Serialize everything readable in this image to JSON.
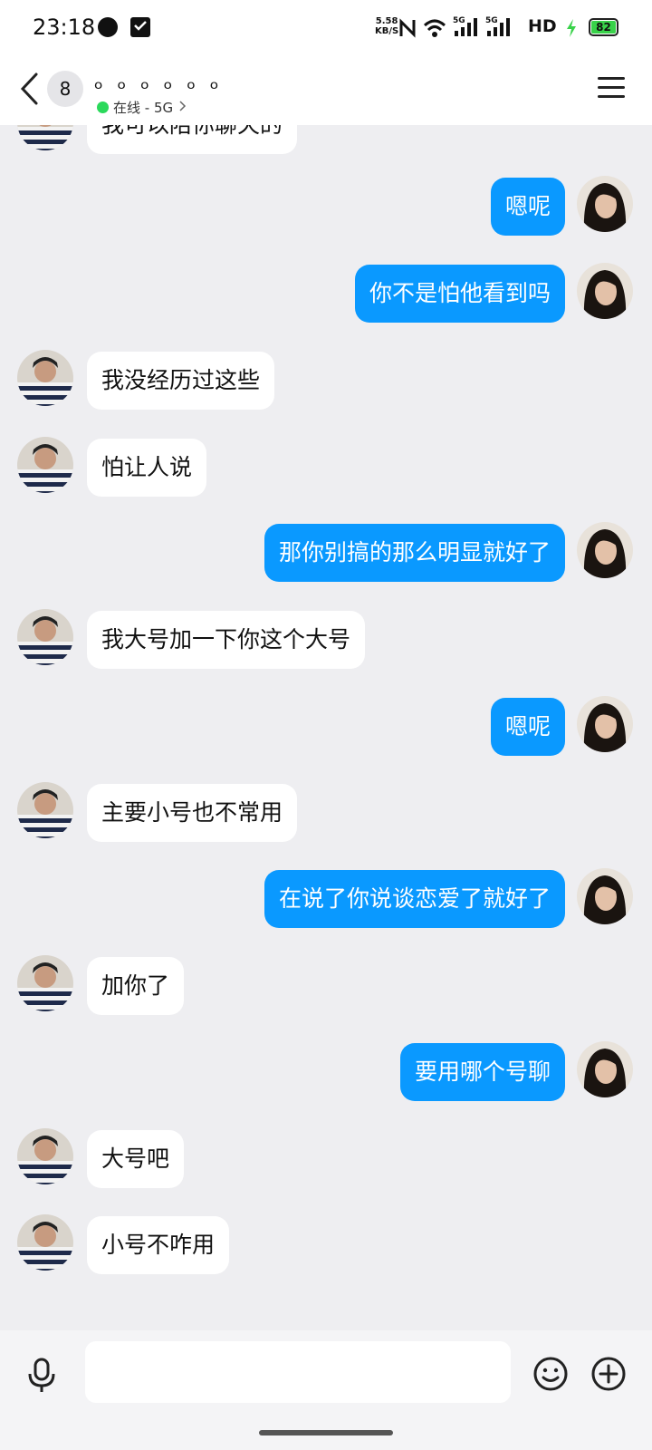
{
  "status_bar": {
    "time": "23:18",
    "net_speed_value": "5.58",
    "net_speed_unit": "KB/S",
    "nfc_icon": "nfc-icon",
    "signal_1_label": "5G",
    "signal_2_label": "5G",
    "hd_label": "HD",
    "battery": "82",
    "charging_color": "#39D24A"
  },
  "header": {
    "unread_count": "8",
    "title": "ₒ ₒ ₒ ₒ ₒ ₒ",
    "status": "在线 - 5G",
    "online_color": "#2BD95B"
  },
  "messages": [
    {
      "side": "left",
      "text": "我可以陪你聊天的"
    },
    {
      "side": "right",
      "text": "嗯呢"
    },
    {
      "side": "right",
      "text": "你不是怕他看到吗"
    },
    {
      "side": "left",
      "text": "我没经历过这些"
    },
    {
      "side": "left",
      "text": "怕让人说"
    },
    {
      "side": "right",
      "text": "那你别搞的那么明显就好了"
    },
    {
      "side": "left",
      "text": "我大号加一下你这个大号"
    },
    {
      "side": "right",
      "text": "嗯呢"
    },
    {
      "side": "left",
      "text": "主要小号也不常用"
    },
    {
      "side": "right",
      "text": "在说了你说谈恋爱了就好了"
    },
    {
      "side": "left",
      "text": "加你了"
    },
    {
      "side": "right",
      "text": "要用哪个号聊"
    },
    {
      "side": "left",
      "text": "大号吧"
    },
    {
      "side": "left",
      "text": "小号不咋用"
    }
  ],
  "input": {
    "value": "",
    "placeholder": ""
  },
  "colors": {
    "self_bubble": "#0A99FF",
    "other_bubble": "#FFFFFF",
    "background": "#EEEEF1"
  }
}
